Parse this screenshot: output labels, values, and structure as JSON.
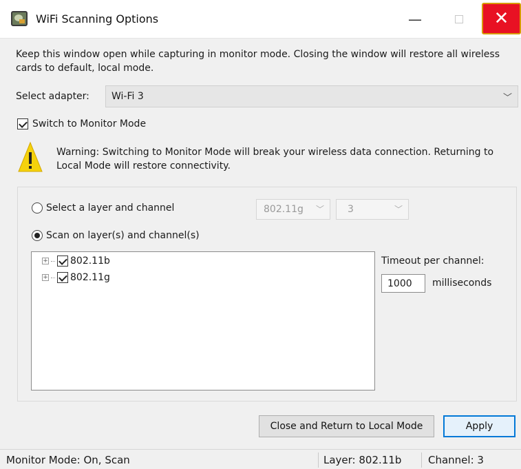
{
  "window": {
    "title": "WiFi Scanning Options",
    "minimize_glyph": "—",
    "close_glyph": "✕"
  },
  "info_text": "Keep this window open while capturing in monitor mode. Closing the window will restore all wireless cards to default, local mode.",
  "adapter": {
    "label": "Select adapter:",
    "value": "Wi-Fi 3"
  },
  "monitor_mode": {
    "label": "Switch to Monitor Mode",
    "checked": true
  },
  "warning": {
    "icon": "warning-icon",
    "text": "Warning: Switching to Monitor Mode will break your wireless data connection. Returning to Local Mode will restore connectivity."
  },
  "scan": {
    "option_layer_channel": "Select a layer and channel",
    "layer_value": "802.11g",
    "channel_value": "3",
    "option_scan_layers": "Scan on layer(s) and channel(s)",
    "selected_option": "scan_layers",
    "tree_items": [
      {
        "label": "802.11b",
        "checked": true
      },
      {
        "label": "802.11g",
        "checked": true
      }
    ],
    "timeout_label": "Timeout per channel:",
    "timeout_value": "1000",
    "timeout_unit": "milliseconds"
  },
  "buttons": {
    "close_local": "Close and Return to Local Mode",
    "apply": "Apply"
  },
  "status": {
    "mode": "Monitor Mode: On, Scan",
    "layer": "Layer: 802.11b",
    "channel": "Channel: 3"
  },
  "colors": {
    "close_red": "#e81123",
    "accent_blue": "#0078d7",
    "warning_yellow": "#f5d20c"
  }
}
